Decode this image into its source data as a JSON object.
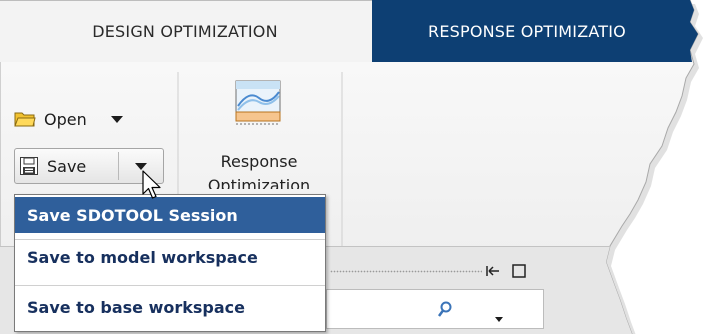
{
  "tabs": [
    {
      "label": "DESIGN OPTIMIZATION",
      "active": true
    },
    {
      "label": "RESPONSE OPTIMIZATIO",
      "active": false
    }
  ],
  "toolbar": {
    "open_label": "Open",
    "save_label": "Save",
    "response_optimization_label_line1": "Response",
    "response_optimization_label_line2": "Optimization"
  },
  "save_menu": {
    "items": [
      {
        "label": "Save SDOTOOL Session",
        "highlighted": true
      },
      {
        "label": "Save to model workspace",
        "highlighted": false
      },
      {
        "label": "Save to base workspace",
        "highlighted": false
      }
    ]
  },
  "colors": {
    "active_tab_bg": "#f3f3f3",
    "inactive_tab_bg": "#0d3f73",
    "toolbar_bg": "#f4f4f4",
    "menu_highlight": "#2f5f9b",
    "menu_text": "#17305e"
  },
  "icons": [
    "folder-icon",
    "floppy-disk-icon",
    "response-optimization-icon",
    "mouse-cursor-icon",
    "search-icon",
    "dock-icon",
    "maximize-icon"
  ]
}
